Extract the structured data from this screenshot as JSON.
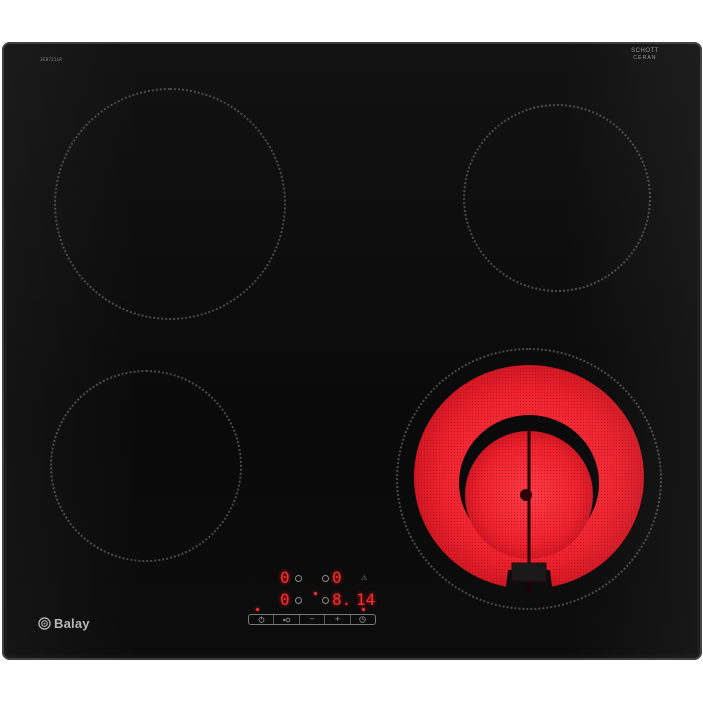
{
  "hob": {
    "model_label": "3EB721LR",
    "glass_brand_line1": "SCHOTT",
    "glass_brand_line2": "CERAN",
    "glass_brand_line3": "",
    "maker": "Balay",
    "glass_color": "#0d0d0d",
    "heat_color": "#ff2a3a"
  },
  "controls": {
    "display_1": "0",
    "display_2": "0",
    "display_3": "0",
    "display_4": "8.",
    "display_5": "14",
    "warning_symbol": "⚠",
    "tiny_label": "",
    "keys": [
      {
        "label": "",
        "icon": "power-icon"
      },
      {
        "label": "",
        "icon": "zone-select-icon"
      },
      {
        "label": "−",
        "icon": "minus-icon"
      },
      {
        "label": "+",
        "icon": "plus-icon"
      },
      {
        "label": "",
        "icon": "timer-icon"
      }
    ]
  }
}
